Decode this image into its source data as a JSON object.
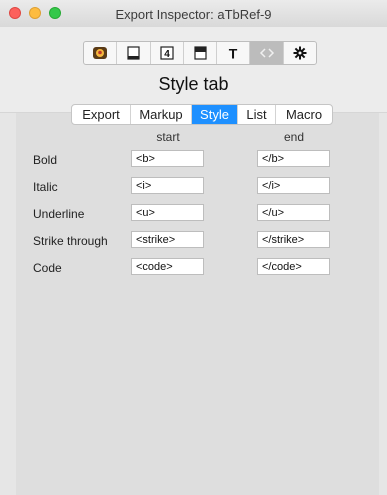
{
  "window": {
    "title": "Export Inspector: aTbRef-9"
  },
  "toolbar": {
    "buttons": [
      {
        "name": "app-icon"
      },
      {
        "name": "page-icon"
      },
      {
        "name": "number-4-icon",
        "glyph": "4"
      },
      {
        "name": "window-icon"
      },
      {
        "name": "text-icon",
        "glyph": "T"
      },
      {
        "name": "code-brackets-icon",
        "glyph": "<>"
      },
      {
        "name": "gear-icon",
        "glyph": "✱"
      }
    ],
    "active_index": 5
  },
  "panel": {
    "title": "Style tab"
  },
  "tabs": [
    {
      "label": "Export"
    },
    {
      "label": "Markup"
    },
    {
      "label": "Style"
    },
    {
      "label": "List"
    },
    {
      "label": "Macro"
    }
  ],
  "columns": {
    "start": "start",
    "end": "end"
  },
  "rows": [
    {
      "label": "Bold",
      "start": "<b>",
      "end": "</b>"
    },
    {
      "label": "Italic",
      "start": "<i>",
      "end": "</i>"
    },
    {
      "label": "Underline",
      "start": "<u>",
      "end": "</u>"
    },
    {
      "label": "Strike through",
      "start": "<strike>",
      "end": "</strike>"
    },
    {
      "label": "Code",
      "start": "<code>",
      "end": "</code>"
    }
  ],
  "colors": {
    "accent": "#1e90ff"
  }
}
